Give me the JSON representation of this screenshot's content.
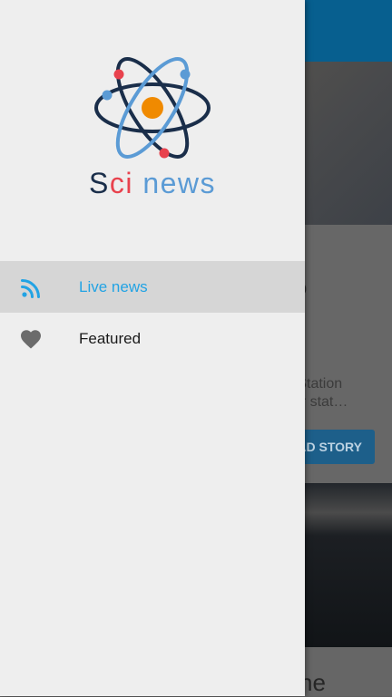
{
  "app": {
    "name_parts": [
      "S",
      "ci",
      " news"
    ],
    "colors": {
      "dark": "#1a2e4a",
      "red": "#e8424d",
      "blue": "#5b9bd5",
      "accent": "#22a3e4",
      "orange": "#f08a00"
    }
  },
  "logo": {
    "icon": "atom-icon"
  },
  "nav": {
    "items": [
      {
        "label": "Live news",
        "icon": "rss-icon",
        "selected": true
      },
      {
        "label": "Featured",
        "icon": "heart-icon",
        "selected": false
      }
    ]
  },
  "background": {
    "card1": {
      "title_fragment": "o",
      "description_lines": [
        "e Station",
        "ber stat…"
      ],
      "button_label": "AD STORY"
    },
    "card2": {
      "title_fragment": "he"
    }
  }
}
